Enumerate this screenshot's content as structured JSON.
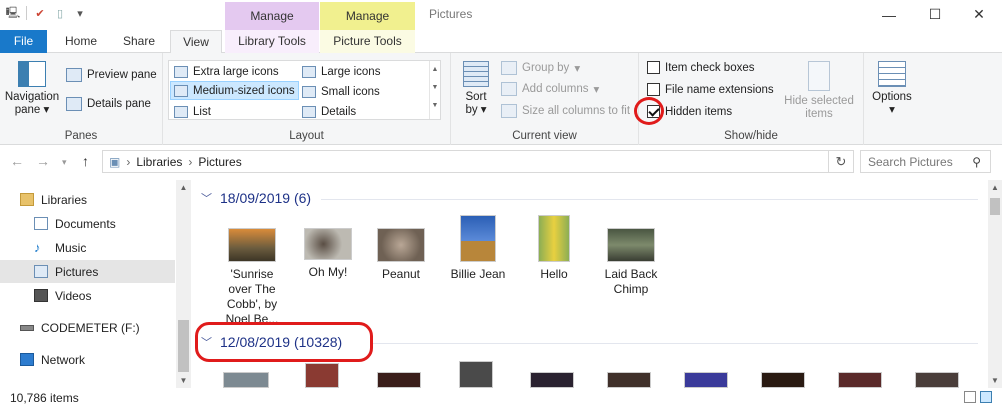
{
  "window": {
    "title": "Pictures",
    "contextual_tabs": {
      "library": "Manage",
      "picture": "Manage"
    }
  },
  "tabs": {
    "file": "File",
    "home": "Home",
    "share": "Share",
    "view": "View",
    "library_tools": "Library Tools",
    "picture_tools": "Picture Tools"
  },
  "ribbon": {
    "panes": {
      "label": "Panes",
      "navigation_pane": "Navigation",
      "navigation_pane_2": "pane",
      "preview_pane": "Preview pane",
      "details_pane": "Details pane"
    },
    "layout": {
      "label": "Layout",
      "items": {
        "extra_large": "Extra large icons",
        "large": "Large icons",
        "medium": "Medium-sized icons",
        "small": "Small icons",
        "list": "List",
        "details": "Details"
      },
      "selected": "Medium-sized icons"
    },
    "current_view": {
      "label": "Current view",
      "sort_by": "Sort",
      "sort_by_2": "by",
      "group_by": "Group by",
      "add_columns": "Add columns",
      "size_all_columns": "Size all columns to fit"
    },
    "show_hide": {
      "label": "Show/hide",
      "item_check_boxes": {
        "label": "Item check boxes",
        "checked": false
      },
      "file_name_extensions": {
        "label": "File name extensions",
        "checked": false
      },
      "hidden_items": {
        "label": "Hidden items",
        "checked": true
      },
      "hide_selected_items": "Hide selected",
      "hide_selected_items_2": "items"
    },
    "options": {
      "label": "Options"
    }
  },
  "address": {
    "path": [
      "Libraries",
      "Pictures"
    ],
    "search_placeholder": "Search Pictures"
  },
  "nav": {
    "items": [
      {
        "label": "Libraries",
        "icon": "libraries-icon"
      },
      {
        "label": "Documents",
        "icon": "documents-icon"
      },
      {
        "label": "Music",
        "icon": "music-icon"
      },
      {
        "label": "Pictures",
        "icon": "pictures-icon",
        "selected": true
      },
      {
        "label": "Videos",
        "icon": "videos-icon"
      },
      {
        "label": "CODEMETER (F:)",
        "icon": "drive-icon"
      },
      {
        "label": "Network",
        "icon": "network-icon"
      }
    ]
  },
  "content": {
    "groups": [
      {
        "header": "18/09/2019 (6)",
        "items": [
          {
            "name_1": "'Sunrise",
            "name_2": "over The",
            "name_3": "Cobb', by",
            "name_4": "Noel Be...",
            "color": "#6b5c3e"
          },
          {
            "name_1": "Oh My!",
            "color": "#9c9a92"
          },
          {
            "name_1": "Peanut",
            "color": "#8b7d6e"
          },
          {
            "name_1": "Billie Jean",
            "color": "#3a66b5"
          },
          {
            "name_1": "Hello",
            "color": "#d9c23a"
          },
          {
            "name_1": "Laid Back",
            "name_2": "Chimp",
            "color": "#5f6b55"
          }
        ]
      },
      {
        "header": "12/08/2019 (10328)"
      }
    ]
  },
  "status": {
    "item_count": "10,786 items"
  },
  "colors": {
    "accent": "#1979ca",
    "annotation": "#e01b1b",
    "group_header": "#1e3287"
  }
}
